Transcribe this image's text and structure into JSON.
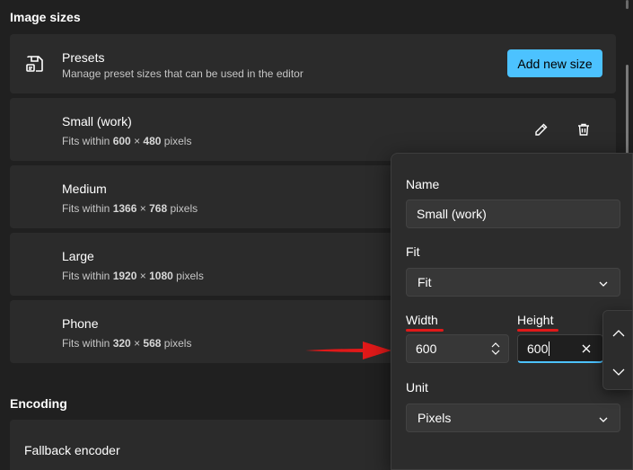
{
  "image_sizes": {
    "section_title": "Image sizes",
    "presets": {
      "title": "Presets",
      "subtitle": "Manage preset sizes that can be used in the editor",
      "add_button_label": "Add new size"
    },
    "items": [
      {
        "name": "Small (work)",
        "fits_prefix": "Fits within",
        "width": "600",
        "times": "×",
        "height": "480",
        "unit": "pixels"
      },
      {
        "name": "Medium",
        "fits_prefix": "Fits within",
        "width": "1366",
        "times": "×",
        "height": "768",
        "unit": "pixels"
      },
      {
        "name": "Large",
        "fits_prefix": "Fits within",
        "width": "1920",
        "times": "×",
        "height": "1080",
        "unit": "pixels"
      },
      {
        "name": "Phone",
        "fits_prefix": "Fits within",
        "width": "320",
        "times": "×",
        "height": "568",
        "unit": "pixels"
      }
    ]
  },
  "encoding": {
    "section_title": "Encoding",
    "fallback_label": "Fallback encoder"
  },
  "edit_flyout": {
    "name_label": "Name",
    "name_value": "Small (work)",
    "fit_label": "Fit",
    "fit_value": "Fit",
    "width_label": "Width",
    "width_value": "600",
    "height_label": "Height",
    "height_value": "600",
    "unit_label": "Unit",
    "unit_value": "Pixels"
  },
  "icons": {
    "presets": "save-preset-icon",
    "edit": "pencil-icon",
    "delete": "trash-icon",
    "chevron": "chevron-down-icon",
    "spinner": "updown-spinner-icon",
    "clear": "close-icon",
    "spin_up": "chevron-up-icon",
    "spin_down": "chevron-down-icon"
  },
  "colors": {
    "accent": "#4cc2ff",
    "annotation": "#e01919",
    "background": "#202020",
    "card": "#2b2b2b"
  }
}
